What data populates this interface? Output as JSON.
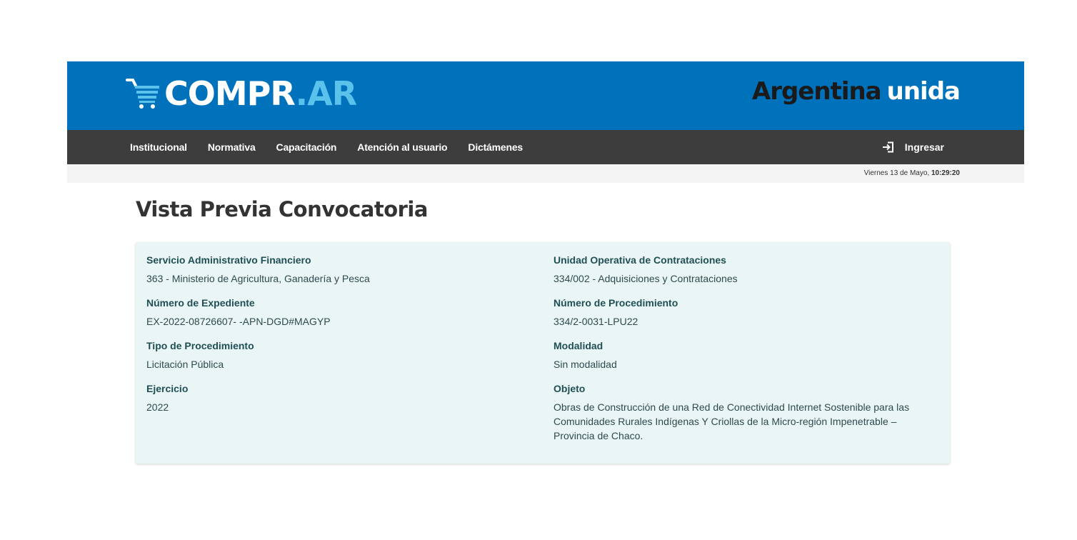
{
  "header": {
    "logo_main": "COMPR",
    "logo_accent": ".AR",
    "brand_part1": "Argentina",
    "brand_part2": "unida",
    "colors": {
      "primary": "#0072bb",
      "accent": "#5bc2ec",
      "nav": "#3d3d3d"
    }
  },
  "nav": {
    "items": [
      "Institucional",
      "Normativa",
      "Capacitación",
      "Atención al usuario",
      "Dictámenes"
    ],
    "login_label": "Ingresar",
    "login_icon": "login-icon"
  },
  "date": {
    "date_text": "Viernes 13 de Mayo, ",
    "time_text": "10:29:20"
  },
  "page": {
    "title": "Vista Previa Convocatoria"
  },
  "details": {
    "left": [
      {
        "label": "Servicio Administrativo Financiero",
        "value": "363 - Ministerio de Agricultura, Ganadería y Pesca"
      },
      {
        "label": "Número de Expediente",
        "value": "EX-2022-08726607- -APN-DGD#MAGYP"
      },
      {
        "label": "Tipo de Procedimiento",
        "value": "Licitación Pública"
      },
      {
        "label": "Ejercicio",
        "value": "2022"
      }
    ],
    "right": [
      {
        "label": "Unidad Operativa de Contrataciones",
        "value": "334/002 - Adquisiciones y Contrataciones"
      },
      {
        "label": "Número de Procedimiento",
        "value": "334/2-0031-LPU22"
      },
      {
        "label": "Modalidad",
        "value": "Sin modalidad"
      },
      {
        "label": "Objeto",
        "value": "Obras de Construcción de una Red de Conectividad Internet Sostenible para las Comunidades Rurales Indígenas Y Criollas de la Micro-región Impenetrable – Provincia de Chaco."
      }
    ]
  }
}
